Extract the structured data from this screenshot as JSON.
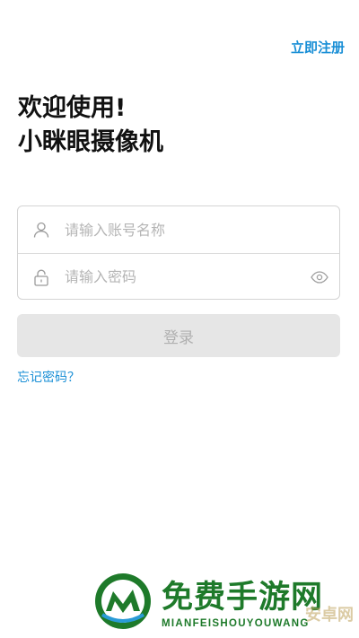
{
  "header": {
    "register_label": "立即注册"
  },
  "welcome": {
    "line1": "欢迎使用!",
    "line2": "小眯眼摄像机"
  },
  "form": {
    "account_placeholder": "请输入账号名称",
    "password_placeholder": "请输入密码",
    "account_icon": "user-icon",
    "password_icon": "lock-icon",
    "toggle_icon": "eye-icon"
  },
  "login_label": "登录",
  "forgot_label": "忘记密码？",
  "watermark": {
    "title": "免费手游网",
    "subtitle": "MIANFEISHOUYOUWANG",
    "faint": "安卓网"
  },
  "colors": {
    "accent": "#1a8fd6",
    "disabled_button": "#e6e6e6",
    "watermark_green": "#1e7a2a"
  }
}
